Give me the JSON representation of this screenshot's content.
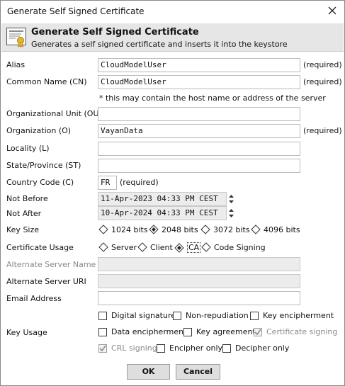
{
  "window": {
    "title": "Generate Self Signed Certificate"
  },
  "header": {
    "title": "Generate Self Signed Certificate",
    "subtitle": "Generates a self signed certificate and inserts it into the keystore",
    "icon": "certificate-icon"
  },
  "form": {
    "alias": {
      "label": "Alias",
      "value": "CloudModelUser",
      "required": "(required)"
    },
    "common_name": {
      "label": "Common Name (CN)",
      "value": "CloudModelUser",
      "required": "(required)",
      "note": "* this may contain the host name or address of the server"
    },
    "org_unit": {
      "label": "Organizational Unit (OU)",
      "value": ""
    },
    "organization": {
      "label": "Organization (O)",
      "value": "VayanData",
      "required": "(required)"
    },
    "locality": {
      "label": "Locality (L)",
      "value": ""
    },
    "state": {
      "label": "State/Province (ST)",
      "value": ""
    },
    "country": {
      "label": "Country Code (C)",
      "value": "FR",
      "required": "(required)"
    },
    "not_before": {
      "label": "Not Before",
      "value": "11-Apr-2023 04:33 PM CEST"
    },
    "not_after": {
      "label": "Not After",
      "value": "10-Apr-2024 04:33 PM CEST"
    },
    "key_size": {
      "label": "Key Size",
      "options": [
        "1024 bits",
        "2048 bits",
        "3072 bits",
        "4096 bits"
      ],
      "selected": "2048 bits"
    },
    "cert_usage": {
      "label": "Certificate Usage",
      "options": [
        "Server",
        "Client",
        "CA",
        "Code Signing"
      ],
      "selected": "CA"
    },
    "alt_server_name": {
      "label": "Alternate Server Name",
      "value": ""
    },
    "alt_server_uri": {
      "label": "Alternate Server URI",
      "value": ""
    },
    "email": {
      "label": "Email Address",
      "value": ""
    },
    "key_usage": {
      "label": "Key Usage",
      "items": [
        {
          "label": "Digital signature",
          "checked": false,
          "enabled": true
        },
        {
          "label": "Non-repudiation",
          "checked": false,
          "enabled": true
        },
        {
          "label": "Key encipherment",
          "checked": false,
          "enabled": true
        },
        {
          "label": "Data encipherment",
          "checked": false,
          "enabled": true
        },
        {
          "label": "Key agreement",
          "checked": false,
          "enabled": true
        },
        {
          "label": "Certificate signing",
          "checked": true,
          "enabled": false
        },
        {
          "label": "CRL signing",
          "checked": true,
          "enabled": false
        },
        {
          "label": "Encipher only",
          "checked": false,
          "enabled": true
        },
        {
          "label": "Decipher only",
          "checked": false,
          "enabled": true
        }
      ]
    }
  },
  "buttons": {
    "ok": "OK",
    "cancel": "Cancel"
  }
}
